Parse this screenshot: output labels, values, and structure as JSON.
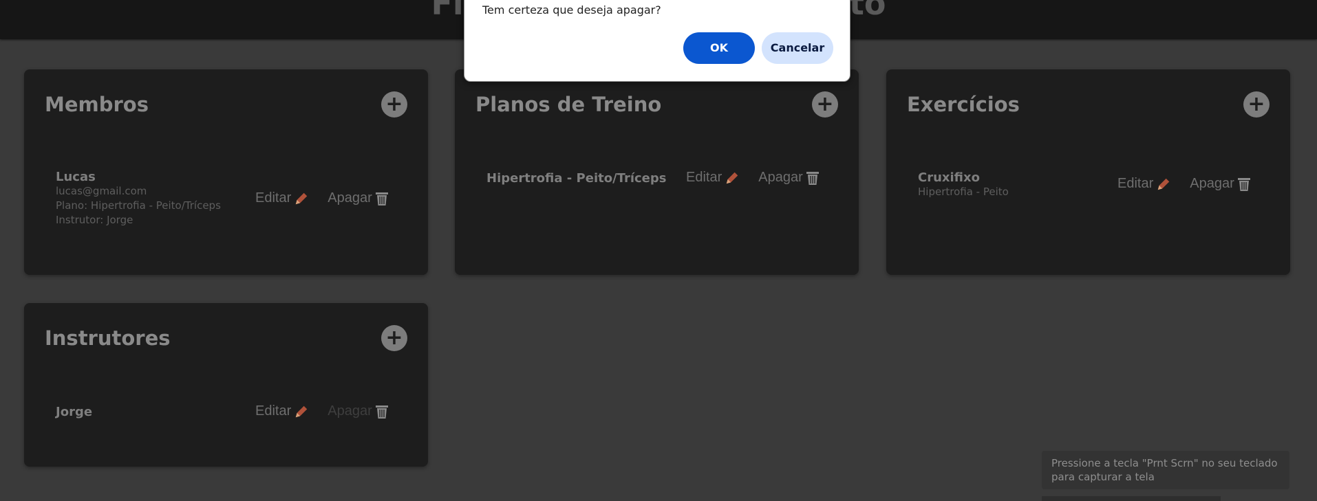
{
  "app": {
    "title": "Fitguide - Gerenciamento"
  },
  "dialog": {
    "message": "Tem certeza que deseja apagar?",
    "ok_label": "OK",
    "cancel_label": "Cancelar"
  },
  "actions": {
    "edit_label": "Editar",
    "delete_label": "Apagar"
  },
  "icons": {
    "add": "plus-icon",
    "edit": "pencil-icon",
    "delete": "trash-icon"
  },
  "colors": {
    "pencil": "#b0523a",
    "primary_button": "#0b57d0",
    "secondary_button": "#d3e3fd"
  },
  "members": {
    "title": "Membros",
    "items": [
      {
        "name": "Lucas",
        "email": "lucas@gmail.com",
        "plan": "Plano: Hipertrofia - Peito/Tríceps",
        "instructor": "Instrutor: Jorge"
      }
    ]
  },
  "plans": {
    "title": "Planos de Treino",
    "items": [
      {
        "name": "Hipertrofia - Peito/Tríceps"
      }
    ]
  },
  "exercises": {
    "title": "Exercícios",
    "items": [
      {
        "name": "Cruxifixo",
        "plan": "Hipertrofia - Peito"
      }
    ]
  },
  "instructors": {
    "title": "Instrutores",
    "items": [
      {
        "name": "Jorge",
        "delete_disabled": true
      }
    ]
  },
  "toast": {
    "text": "Pressione a tecla \"Prnt Scrn\" no seu teclado para capturar a tela"
  }
}
